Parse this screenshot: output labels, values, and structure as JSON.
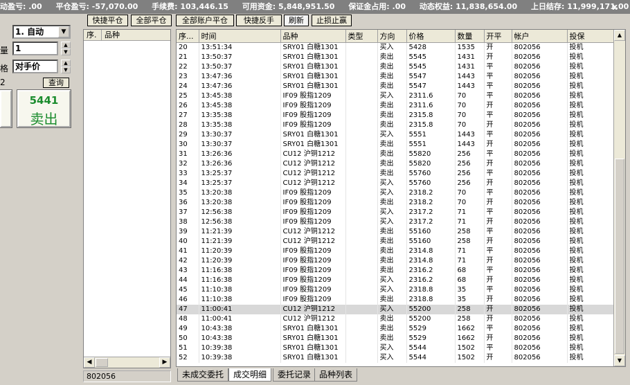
{
  "status_bar": {
    "items": [
      "动盈亏: .00",
      "平仓盈亏: -57,070.00",
      "手续费: 103,446.15",
      "可用资金: 5,848,951.50",
      "保证金占用: .00",
      "动态权益: 11,838,654.00",
      "上日结存: 11,999,171.00"
    ],
    "close_glyph": "x"
  },
  "order_panel": {
    "mode_value": "1. 自动",
    "qty_label": "量",
    "qty_value": "1",
    "price_label": "格",
    "price_value": "对手价",
    "side_value": "2",
    "query_label": "查询",
    "sell_price": "5441",
    "sell_label": "卖出"
  },
  "toolbar": {
    "quick_close": "快捷平仓",
    "close_all": "全部平仓",
    "close_all_accounts": "全部账户平仓",
    "quick_reverse": "快捷反手",
    "refresh": "刷新",
    "stop_loss": "止损止赢"
  },
  "position_list": {
    "col_seq": "序.",
    "col_symbol": "品种",
    "account": "802056"
  },
  "trades": {
    "columns": [
      "序...",
      "时间",
      "品种",
      "类型",
      "方向",
      "价格",
      "数量",
      "开平",
      "帐户",
      "投保"
    ],
    "rows": [
      [
        "20",
        "13:51:34",
        "SRY01 白糖1301",
        "",
        "买入",
        "5428",
        "1535",
        "开",
        "802056",
        "投机"
      ],
      [
        "21",
        "13:50:37",
        "SRY01 白糖1301",
        "",
        "卖出",
        "5545",
        "1431",
        "开",
        "802056",
        "投机"
      ],
      [
        "22",
        "13:50:37",
        "SRY01 白糖1301",
        "",
        "卖出",
        "5545",
        "1431",
        "平",
        "802056",
        "投机"
      ],
      [
        "23",
        "13:47:36",
        "SRY01 白糖1301",
        "",
        "卖出",
        "5547",
        "1443",
        "平",
        "802056",
        "投机"
      ],
      [
        "24",
        "13:47:36",
        "SRY01 白糖1301",
        "",
        "卖出",
        "5547",
        "1443",
        "平",
        "802056",
        "投机"
      ],
      [
        "25",
        "13:45:38",
        "IF09 股指1209",
        "",
        "买入",
        "2311.6",
        "70",
        "平",
        "802056",
        "投机"
      ],
      [
        "26",
        "13:45:38",
        "IF09 股指1209",
        "",
        "卖出",
        "2311.6",
        "70",
        "开",
        "802056",
        "投机"
      ],
      [
        "27",
        "13:35:38",
        "IF09 股指1209",
        "",
        "卖出",
        "2315.8",
        "70",
        "平",
        "802056",
        "投机"
      ],
      [
        "28",
        "13:35:38",
        "IF09 股指1209",
        "",
        "卖出",
        "2315.8",
        "70",
        "开",
        "802056",
        "投机"
      ],
      [
        "29",
        "13:30:37",
        "SRY01 白糖1301",
        "",
        "买入",
        "5551",
        "1443",
        "平",
        "802056",
        "投机"
      ],
      [
        "30",
        "13:30:37",
        "SRY01 白糖1301",
        "",
        "卖出",
        "5551",
        "1443",
        "开",
        "802056",
        "投机"
      ],
      [
        "31",
        "13:26:36",
        "CU12 沪铜1212",
        "",
        "卖出",
        "55820",
        "256",
        "平",
        "802056",
        "投机"
      ],
      [
        "32",
        "13:26:36",
        "CU12 沪铜1212",
        "",
        "卖出",
        "55820",
        "256",
        "开",
        "802056",
        "投机"
      ],
      [
        "33",
        "13:25:37",
        "CU12 沪铜1212",
        "",
        "卖出",
        "55760",
        "256",
        "平",
        "802056",
        "投机"
      ],
      [
        "34",
        "13:25:37",
        "CU12 沪铜1212",
        "",
        "买入",
        "55760",
        "256",
        "开",
        "802056",
        "投机"
      ],
      [
        "35",
        "13:20:38",
        "IF09 股指1209",
        "",
        "买入",
        "2318.2",
        "70",
        "平",
        "802056",
        "投机"
      ],
      [
        "36",
        "13:20:38",
        "IF09 股指1209",
        "",
        "卖出",
        "2318.2",
        "70",
        "开",
        "802056",
        "投机"
      ],
      [
        "37",
        "12:56:38",
        "IF09 股指1209",
        "",
        "买入",
        "2317.2",
        "71",
        "平",
        "802056",
        "投机"
      ],
      [
        "38",
        "12:56:38",
        "IF09 股指1209",
        "",
        "买入",
        "2317.2",
        "71",
        "开",
        "802056",
        "投机"
      ],
      [
        "39",
        "11:21:39",
        "CU12 沪铜1212",
        "",
        "卖出",
        "55160",
        "258",
        "平",
        "802056",
        "投机"
      ],
      [
        "40",
        "11:21:39",
        "CU12 沪铜1212",
        "",
        "卖出",
        "55160",
        "258",
        "开",
        "802056",
        "投机"
      ],
      [
        "41",
        "11:20:39",
        "IF09 股指1209",
        "",
        "卖出",
        "2314.8",
        "71",
        "平",
        "802056",
        "投机"
      ],
      [
        "42",
        "11:20:39",
        "IF09 股指1209",
        "",
        "卖出",
        "2314.8",
        "71",
        "开",
        "802056",
        "投机"
      ],
      [
        "43",
        "11:16:38",
        "IF09 股指1209",
        "",
        "卖出",
        "2316.2",
        "68",
        "平",
        "802056",
        "投机"
      ],
      [
        "44",
        "11:16:38",
        "IF09 股指1209",
        "",
        "买入",
        "2316.2",
        "68",
        "开",
        "802056",
        "投机"
      ],
      [
        "45",
        "11:10:38",
        "IF09 股指1209",
        "",
        "买入",
        "2318.8",
        "35",
        "平",
        "802056",
        "投机"
      ],
      [
        "46",
        "11:10:38",
        "IF09 股指1209",
        "",
        "卖出",
        "2318.8",
        "35",
        "开",
        "802056",
        "投机"
      ],
      [
        "47",
        "11:00:41",
        "CU12 沪铜1212",
        "",
        "买入",
        "55200",
        "258",
        "开",
        "802056",
        "投机"
      ],
      [
        "48",
        "11:00:41",
        "CU12 沪铜1212",
        "",
        "卖出",
        "55200",
        "258",
        "开",
        "802056",
        "投机"
      ],
      [
        "49",
        "10:43:38",
        "SRY01 白糖1301",
        "",
        "卖出",
        "5529",
        "1662",
        "平",
        "802056",
        "投机"
      ],
      [
        "50",
        "10:43:38",
        "SRY01 白糖1301",
        "",
        "卖出",
        "5529",
        "1662",
        "开",
        "802056",
        "投机"
      ],
      [
        "51",
        "10:39:38",
        "SRY01 白糖1301",
        "",
        "买入",
        "5544",
        "1502",
        "平",
        "802056",
        "投机"
      ],
      [
        "52",
        "10:39:38",
        "SRY01 白糖1301",
        "",
        "买入",
        "5544",
        "1502",
        "开",
        "802056",
        "投机"
      ]
    ],
    "selected_row": 27
  },
  "tabs": [
    "未成交委托",
    "成交明细",
    "委托记录",
    "品种列表"
  ],
  "active_tab": 1,
  "icons": {
    "dropdown": "chevron-down-icon",
    "spin_up": "arrow-up-icon",
    "spin_down": "arrow-down-icon",
    "scroll_left": "arrow-left-icon",
    "scroll_right": "arrow-right-icon",
    "scroll_up": "arrow-up-icon",
    "scroll_down": "arrow-down-icon"
  }
}
